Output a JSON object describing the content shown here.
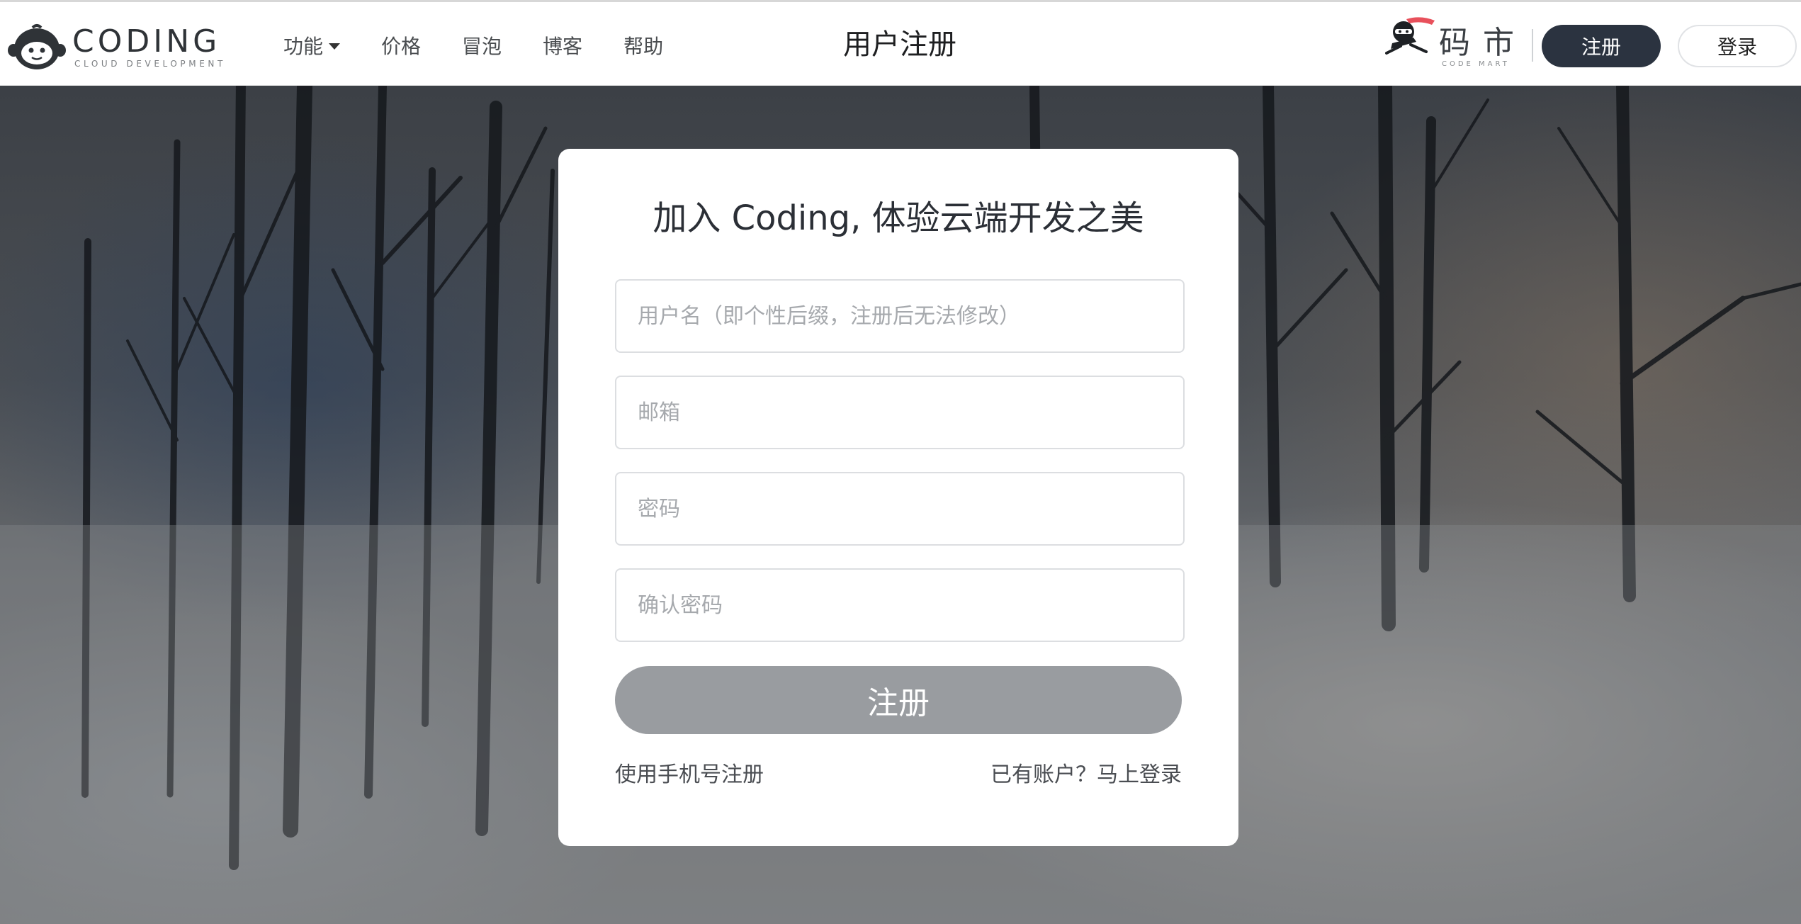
{
  "logo": {
    "wordmark": "CODING",
    "tagline": "CLOUD DEVELOPMENT"
  },
  "nav": {
    "items": [
      {
        "label": "功能",
        "has_dropdown": true
      },
      {
        "label": "价格"
      },
      {
        "label": "冒泡"
      },
      {
        "label": "博客"
      },
      {
        "label": "帮助"
      }
    ]
  },
  "header": {
    "title": "用户注册"
  },
  "mart": {
    "name": "码市",
    "tagline": "CODE MART"
  },
  "auth": {
    "register_label": "注册",
    "login_label": "登录"
  },
  "form": {
    "title": "加入 Coding, 体验云端开发之美",
    "username_placeholder": "用户名（即个性后缀，注册后无法修改）",
    "email_placeholder": "邮箱",
    "password_placeholder": "密码",
    "confirm_placeholder": "确认密码",
    "submit_label": "注册",
    "phone_link": "使用手机号注册",
    "login_link": "已有账户？马上登录"
  },
  "colors": {
    "header_bg": "#ffffff",
    "primary_dark": "#2b3340",
    "submit_disabled": "#999ca0",
    "card_bg": "#ffffff"
  },
  "icons": {
    "logo": "monkey-logo-icon",
    "mart": "ninja-logo-icon",
    "dropdown": "caret-down-icon"
  }
}
